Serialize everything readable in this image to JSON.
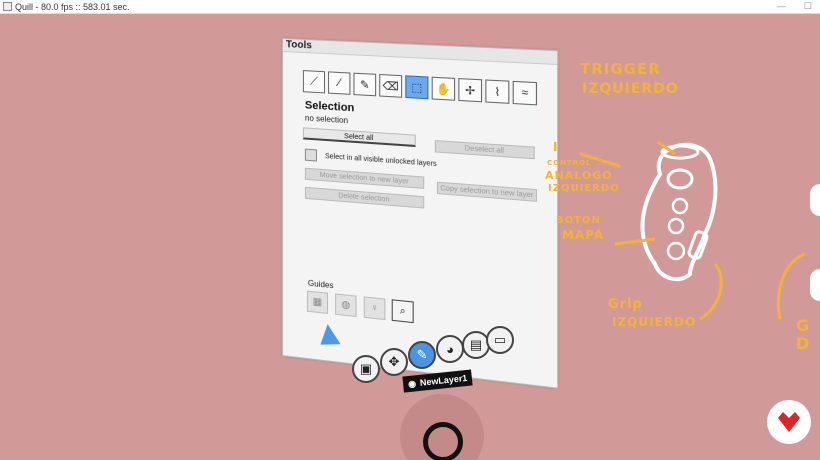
{
  "window": {
    "title": "Quill - 80.0 fps :: 583.01 sec."
  },
  "panel": {
    "title": "Tools",
    "section_title": "Selection",
    "section_subtitle": "no selection",
    "tools": [
      {
        "name": "brush-tool",
        "icon": "brush-icon",
        "glyph": "⟋"
      },
      {
        "name": "line-tool",
        "icon": "pen-icon",
        "glyph": "∕"
      },
      {
        "name": "paint-tool",
        "icon": "paintbrush-icon",
        "glyph": "✎"
      },
      {
        "name": "eraser-tool",
        "icon": "eraser-icon",
        "glyph": "⌫"
      },
      {
        "name": "selection-tool",
        "icon": "marquee-icon",
        "glyph": "⬚",
        "active": true
      },
      {
        "name": "grab-tool",
        "icon": "hand-icon",
        "glyph": "✋"
      },
      {
        "name": "direction-tool",
        "icon": "arrows-icon",
        "glyph": "✢"
      },
      {
        "name": "smooth-tool",
        "icon": "wave-icon",
        "glyph": "⌇"
      },
      {
        "name": "curve-tool",
        "icon": "curve-icon",
        "glyph": "≈"
      }
    ],
    "select_all": "Select all",
    "deselect_all": "Deselect all",
    "select_visible_label": "Select in all visible unlocked layers",
    "move_selection": "Move selection to new layer",
    "copy_selection": "Copy selection to new layer",
    "delete_selection": "Delete selection",
    "guides_label": "Guides",
    "guides": [
      {
        "name": "guide-grid",
        "icon": "grid-plane-icon",
        "glyph": "▦"
      },
      {
        "name": "guide-sphere",
        "icon": "sphere-icon",
        "glyph": "◍"
      },
      {
        "name": "guide-bulb",
        "icon": "lightbulb-icon",
        "glyph": "♀"
      },
      {
        "name": "guide-zoom",
        "icon": "map-search-icon",
        "glyph": "⌕",
        "active": true
      }
    ]
  },
  "toolbar": {
    "items": [
      {
        "name": "toolbar-picture",
        "icon": "picture-icon",
        "glyph": "▣"
      },
      {
        "name": "toolbar-move",
        "icon": "move-icon",
        "glyph": "✥"
      },
      {
        "name": "toolbar-paint",
        "icon": "brushes-icon",
        "glyph": "✎",
        "active": true
      },
      {
        "name": "toolbar-palette",
        "icon": "palette-icon",
        "glyph": "◕"
      },
      {
        "name": "toolbar-save",
        "icon": "save-icon",
        "glyph": "▤"
      },
      {
        "name": "toolbar-open",
        "icon": "folder-icon",
        "glyph": "▭"
      }
    ],
    "layer_name": "NewLayer1"
  },
  "annotations": {
    "trigger": "TRIGGER",
    "izquierdo_1": "IZQUIERDO",
    "control": "CONTROL",
    "analogo": "ANALOGO",
    "izquierdo_2": "IZQUIERDO",
    "boton": "BOTON",
    "mapa": "MAPA",
    "grip": "Grip",
    "izquierdo_3": "IZQUIERDO",
    "marker_i": "I",
    "edge_g": "G",
    "edge_d": "D"
  },
  "colors": {
    "background": "#d19a98",
    "annotation": "#f5b236",
    "accent": "#4a94e4",
    "logo": "#e02424"
  }
}
